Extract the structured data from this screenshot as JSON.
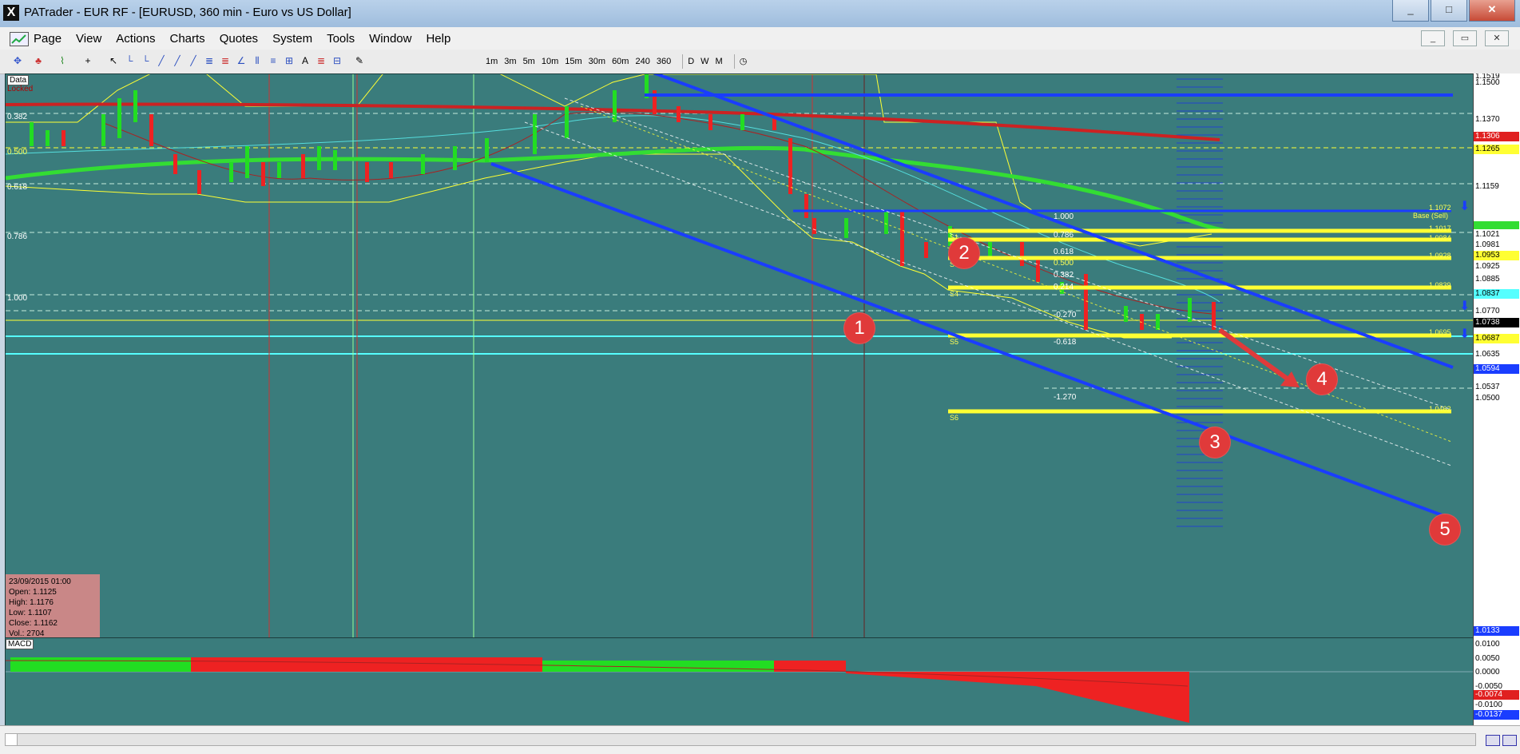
{
  "window": {
    "title": "PATrader - EUR RF - [EURUSD, 360 min - Euro vs US Dollar]",
    "buttons": [
      "_",
      "□",
      "✕"
    ]
  },
  "menu": {
    "items": [
      "Page",
      "View",
      "Actions",
      "Charts",
      "Quotes",
      "System",
      "Tools",
      "Window",
      "Help"
    ],
    "mdi_buttons": [
      "_",
      "▭",
      "✕"
    ]
  },
  "toolbar": {
    "timeframes": [
      "1m",
      "3m",
      "5m",
      "10m",
      "15m",
      "30m",
      "60m",
      "240",
      "360"
    ],
    "periods": [
      "D",
      "W",
      "M"
    ]
  },
  "chart": {
    "tags": {
      "data": "Data",
      "locked": "Locked"
    },
    "left_fib_labels": [
      "0.382",
      "0.500",
      "0.618",
      "0.786",
      "1.000"
    ],
    "fib_labels": [
      "1.000",
      "0.786",
      "0.618",
      "0.500",
      "0.382",
      "0.214",
      "-0.270",
      "-0.618",
      "-1.270"
    ],
    "s_labels": [
      "S1",
      "S2",
      "S3",
      "S4",
      "S5",
      "S6"
    ],
    "right_level_labels": [
      "1.1072",
      "Base (Sell)",
      "1.1017",
      "1.0984",
      "1.0928",
      "1.0839",
      "1.0695",
      "1.0462"
    ],
    "markers": [
      "1",
      "2",
      "3",
      "4",
      "5"
    ],
    "ohlc": {
      "date": "23/09/2015 01:00",
      "open": "Open: 1.1125",
      "high": "High: 1.1176",
      "low": "Low: 1.1107",
      "close": "Close: 1.1162",
      "vol": "Vol.: 2704"
    }
  },
  "price_axis": {
    "labels": [
      "1.1519",
      "1.1500",
      "1.1370",
      "1.1306",
      "1.1265",
      "1.1159",
      "1.1072",
      "1.1021",
      "1.0981",
      "1.0953",
      "1.0925",
      "1.0885",
      "1.0837",
      "1.0770",
      "1.0738",
      "1.0687",
      "1.0635",
      "1.0594",
      "1.0537",
      "1.0500",
      "1.0133"
    ],
    "colors": {
      "1.1306": "#e02020",
      "1.1265": "#ffff33",
      "1.0953": "#ffff33",
      "1.0837": "#55ffff",
      "1.0738": "#000000",
      "1.0687": "#ffff33",
      "1.0594": "#1a3dff",
      "1.0133": "#1a3dff"
    }
  },
  "macd": {
    "label": "MACD",
    "axis_labels": [
      "0.0100",
      "0.0050",
      "0.0000",
      "-0.0050",
      "-0.0100"
    ],
    "tags": {
      "red": "-0.0074",
      "blue": "-0.0137"
    },
    "tag_colors": {
      "red": "#e02020",
      "blue": "#1a3dff"
    }
  },
  "colors": {
    "chart_bg": "#3a7c7c",
    "channel": "#1a3dff",
    "support": "#ffff33",
    "ma_green": "#33dd33",
    "ma_red": "#cc2222"
  }
}
